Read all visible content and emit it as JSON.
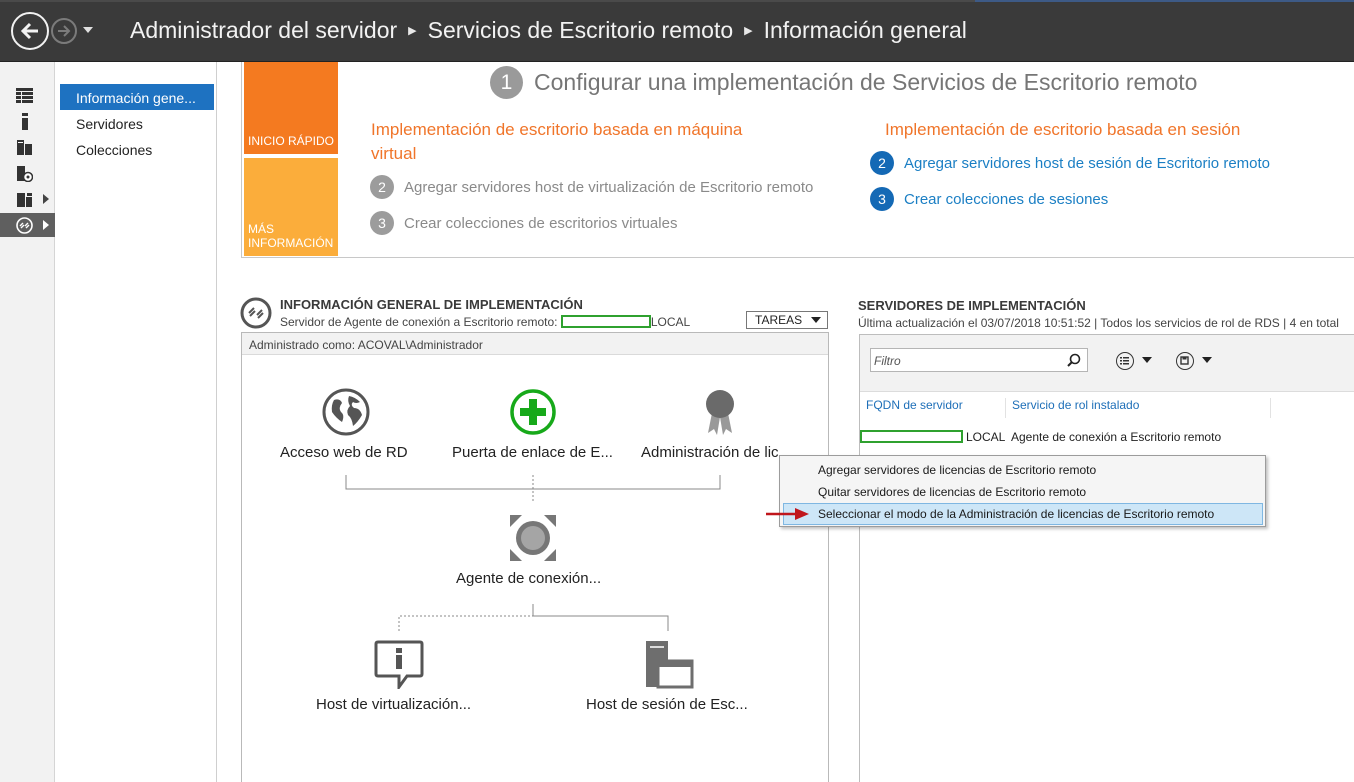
{
  "colors": {
    "titlebar": "#3a3a3a",
    "accent_blue": "#1e72c1",
    "orange": "#f47a20",
    "yellow": "#fbad3b",
    "link_blue": "#1b7fc4",
    "redaction_green": "#2fa12f",
    "arrow_red": "#c0161c"
  },
  "titlebar": {
    "back_icon": "back-arrow-icon",
    "forward_icon": "forward-arrow-icon",
    "crumbs": [
      "Administrador del servidor",
      "Servicios de Escritorio remoto",
      "Información general"
    ]
  },
  "iconbar": {
    "items": [
      "dashboard-icon",
      "local-server-icon",
      "all-servers-icon",
      "file-storage-icon",
      "roles-icon",
      "remote-desktop-icon"
    ]
  },
  "nav": {
    "items": [
      "Información gene...",
      "Servidores",
      "Colecciones"
    ]
  },
  "quickstart": {
    "tile_quick": "INICIO RÁPIDO",
    "tile_more_1": "MÁS",
    "tile_more_2": "INFORMACIÓN",
    "step1_num": "1",
    "title": "Configurar una implementación de Servicios de Escritorio remoto",
    "vm_head_1": "Implementación de escritorio basada en máquina",
    "vm_head_2": "virtual",
    "vm_steps": [
      {
        "num": "2",
        "label": "Agregar servidores host de virtualización de Escritorio remoto"
      },
      {
        "num": "3",
        "label": "Crear colecciones de escritorios virtuales"
      }
    ],
    "session_head": "Implementación de escritorio basada en sesión",
    "session_steps": [
      {
        "num": "2",
        "label": "Agregar servidores host de sesión de Escritorio remoto"
      },
      {
        "num": "3",
        "label": "Crear colecciones de sesiones"
      }
    ]
  },
  "overview": {
    "title": "INFORMACIÓN GENERAL DE IMPLEMENTACIÓN",
    "subtitle_prefix": "Servidor de Agente de conexión a Escritorio remoto:",
    "subtitle_suffix": "LOCAL",
    "tasks": "TAREAS",
    "managed_as": "Administrado como: ACOVAL\\Administrador",
    "nodes": {
      "web": "Acceso web de RD",
      "gateway": "Puerta de enlace de E...",
      "licensing": "Administración de lic...",
      "broker": "Agente de conexión...",
      "virt_host": "Host de virtualización...",
      "session_host": "Host de sesión de Esc..."
    }
  },
  "servers": {
    "title": "SERVIDORES DE IMPLEMENTACIÓN",
    "subtitle": "Última actualización el 03/07/2018 10:51:52 | Todos los servicios de rol de RDS  | 4 en total",
    "filter_placeholder": "Filtro",
    "columns": [
      "FQDN de servidor",
      "Servicio de rol instalado"
    ],
    "rows": [
      {
        "fqdn_suffix": "LOCAL",
        "role": "Agente de conexión a Escritorio remoto"
      }
    ]
  },
  "context_menu": {
    "items": [
      "Agregar servidores de licencias de Escritorio remoto",
      "Quitar servidores de licencias de Escritorio remoto",
      "Seleccionar el modo de la Administración de licencias de Escritorio remoto"
    ],
    "highlighted_index": 2
  }
}
